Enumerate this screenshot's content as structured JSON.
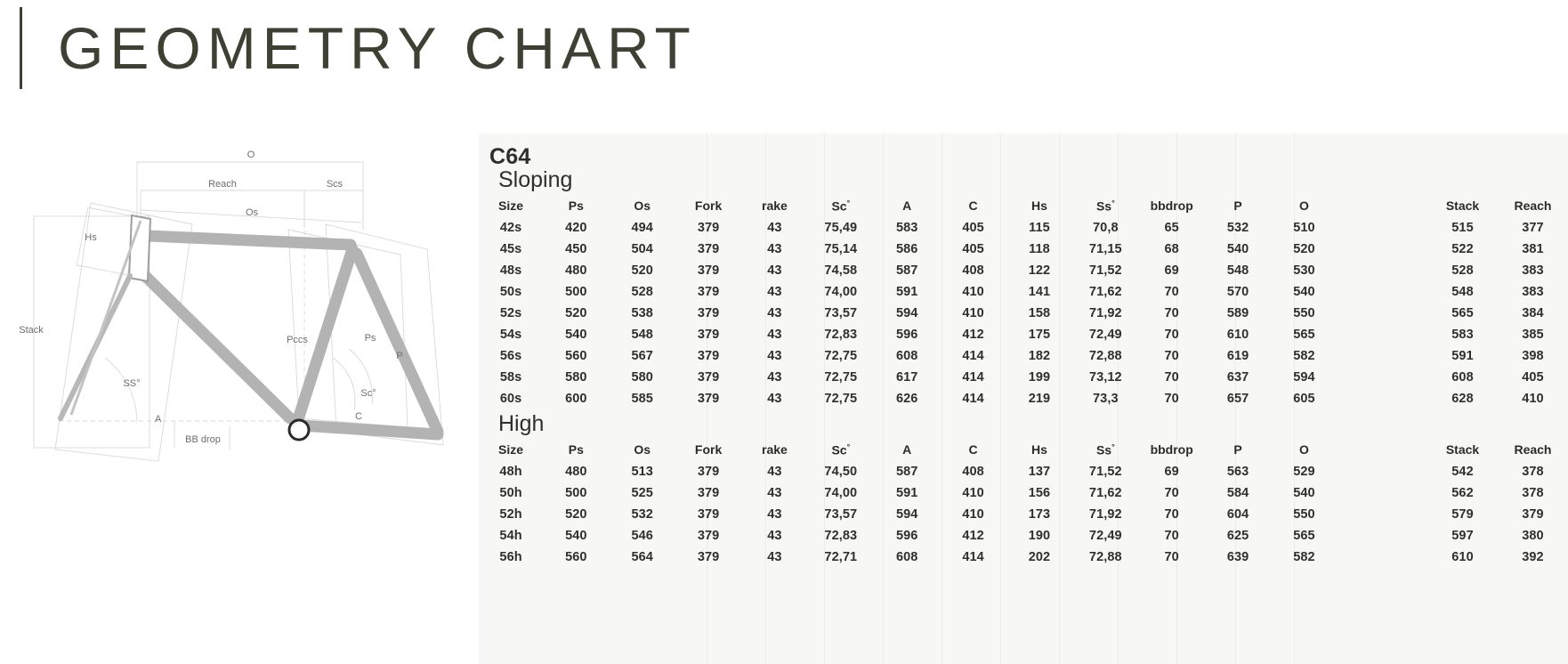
{
  "header": {
    "title": "GEOMETRY CHART",
    "accent_color": "#3e4033"
  },
  "diagram": {
    "name": "bicycle-frame-geometry-diagram",
    "labels": {
      "o": "O",
      "reach": "Reach",
      "scs": "Scs",
      "os": "Os",
      "hs": "Hs",
      "stack": "Stack",
      "pccs": "Pccs",
      "ps": "Ps",
      "p": "P",
      "ss_angle": "SS°",
      "sc_angle": "Sc°",
      "bb_drop": "BB drop",
      "a": "A",
      "c": "C"
    }
  },
  "table": {
    "model": "C64",
    "panel_bg": "#f7f7f6",
    "columns": [
      "Size",
      "Ps",
      "Os",
      "Fork",
      "rake",
      "Sc°",
      "A",
      "C",
      "Hs",
      "Ss°",
      "bbdrop",
      "P",
      "O",
      "",
      "Stack",
      "Reach"
    ],
    "sections": [
      {
        "name": "Sloping",
        "rows": [
          [
            "42s",
            "420",
            "494",
            "379",
            "43",
            "75,49",
            "583",
            "405",
            "115",
            "70,8",
            "65",
            "532",
            "510",
            "",
            "515",
            "377"
          ],
          [
            "45s",
            "450",
            "504",
            "379",
            "43",
            "75,14",
            "586",
            "405",
            "118",
            "71,15",
            "68",
            "540",
            "520",
            "",
            "522",
            "381"
          ],
          [
            "48s",
            "480",
            "520",
            "379",
            "43",
            "74,58",
            "587",
            "408",
            "122",
            "71,52",
            "69",
            "548",
            "530",
            "",
            "528",
            "383"
          ],
          [
            "50s",
            "500",
            "528",
            "379",
            "43",
            "74,00",
            "591",
            "410",
            "141",
            "71,62",
            "70",
            "570",
            "540",
            "",
            "548",
            "383"
          ],
          [
            "52s",
            "520",
            "538",
            "379",
            "43",
            "73,57",
            "594",
            "410",
            "158",
            "71,92",
            "70",
            "589",
            "550",
            "",
            "565",
            "384"
          ],
          [
            "54s",
            "540",
            "548",
            "379",
            "43",
            "72,83",
            "596",
            "412",
            "175",
            "72,49",
            "70",
            "610",
            "565",
            "",
            "583",
            "385"
          ],
          [
            "56s",
            "560",
            "567",
            "379",
            "43",
            "72,75",
            "608",
            "414",
            "182",
            "72,88",
            "70",
            "619",
            "582",
            "",
            "591",
            "398"
          ],
          [
            "58s",
            "580",
            "580",
            "379",
            "43",
            "72,75",
            "617",
            "414",
            "199",
            "73,12",
            "70",
            "637",
            "594",
            "",
            "608",
            "405"
          ],
          [
            "60s",
            "600",
            "585",
            "379",
            "43",
            "72,75",
            "626",
            "414",
            "219",
            "73,3",
            "70",
            "657",
            "605",
            "",
            "628",
            "410"
          ]
        ]
      },
      {
        "name": "High",
        "rows": [
          [
            "48h",
            "480",
            "513",
            "379",
            "43",
            "74,50",
            "587",
            "408",
            "137",
            "71,52",
            "69",
            "563",
            "529",
            "",
            "542",
            "378"
          ],
          [
            "50h",
            "500",
            "525",
            "379",
            "43",
            "74,00",
            "591",
            "410",
            "156",
            "71,62",
            "70",
            "584",
            "540",
            "",
            "562",
            "378"
          ],
          [
            "52h",
            "520",
            "532",
            "379",
            "43",
            "73,57",
            "594",
            "410",
            "173",
            "71,92",
            "70",
            "604",
            "550",
            "",
            "579",
            "379"
          ],
          [
            "54h",
            "540",
            "546",
            "379",
            "43",
            "72,83",
            "596",
            "412",
            "190",
            "72,49",
            "70",
            "625",
            "565",
            "",
            "597",
            "380"
          ],
          [
            "56h",
            "560",
            "564",
            "379",
            "43",
            "72,71",
            "608",
            "414",
            "202",
            "72,88",
            "70",
            "639",
            "582",
            "",
            "610",
            "392"
          ]
        ]
      }
    ]
  },
  "chart_data": {
    "type": "table",
    "title": "GEOMETRY CHART",
    "subtitle": "C64",
    "columns": [
      "Size",
      "Ps",
      "Os",
      "Fork",
      "rake",
      "Sc°",
      "A",
      "C",
      "Hs",
      "Ss°",
      "bbdrop",
      "P",
      "O",
      "Stack",
      "Reach"
    ],
    "groups": [
      {
        "name": "Sloping",
        "rows": [
          {
            "Size": "42s",
            "Ps": 420,
            "Os": 494,
            "Fork": 379,
            "rake": 43,
            "Sc": 75.49,
            "A": 583,
            "C": 405,
            "Hs": 115,
            "Ss": 70.8,
            "bbdrop": 65,
            "P": 532,
            "O": 510,
            "Stack": 515,
            "Reach": 377
          },
          {
            "Size": "45s",
            "Ps": 450,
            "Os": 504,
            "Fork": 379,
            "rake": 43,
            "Sc": 75.14,
            "A": 586,
            "C": 405,
            "Hs": 118,
            "Ss": 71.15,
            "bbdrop": 68,
            "P": 540,
            "O": 520,
            "Stack": 522,
            "Reach": 381
          },
          {
            "Size": "48s",
            "Ps": 480,
            "Os": 520,
            "Fork": 379,
            "rake": 43,
            "Sc": 74.58,
            "A": 587,
            "C": 408,
            "Hs": 122,
            "Ss": 71.52,
            "bbdrop": 69,
            "P": 548,
            "O": 530,
            "Stack": 528,
            "Reach": 383
          },
          {
            "Size": "50s",
            "Ps": 500,
            "Os": 528,
            "Fork": 379,
            "rake": 43,
            "Sc": 74.0,
            "A": 591,
            "C": 410,
            "Hs": 141,
            "Ss": 71.62,
            "bbdrop": 70,
            "P": 570,
            "O": 540,
            "Stack": 548,
            "Reach": 383
          },
          {
            "Size": "52s",
            "Ps": 520,
            "Os": 538,
            "Fork": 379,
            "rake": 43,
            "Sc": 73.57,
            "A": 594,
            "C": 410,
            "Hs": 158,
            "Ss": 71.92,
            "bbdrop": 70,
            "P": 589,
            "O": 550,
            "Stack": 565,
            "Reach": 384
          },
          {
            "Size": "54s",
            "Ps": 540,
            "Os": 548,
            "Fork": 379,
            "rake": 43,
            "Sc": 72.83,
            "A": 596,
            "C": 412,
            "Hs": 175,
            "Ss": 72.49,
            "bbdrop": 70,
            "P": 610,
            "O": 565,
            "Stack": 583,
            "Reach": 385
          },
          {
            "Size": "56s",
            "Ps": 560,
            "Os": 567,
            "Fork": 379,
            "rake": 43,
            "Sc": 72.75,
            "A": 608,
            "C": 414,
            "Hs": 182,
            "Ss": 72.88,
            "bbdrop": 70,
            "P": 619,
            "O": 582,
            "Stack": 591,
            "Reach": 398
          },
          {
            "Size": "58s",
            "Ps": 580,
            "Os": 580,
            "Fork": 379,
            "rake": 43,
            "Sc": 72.75,
            "A": 617,
            "C": 414,
            "Hs": 199,
            "Ss": 73.12,
            "bbdrop": 70,
            "P": 637,
            "O": 594,
            "Stack": 608,
            "Reach": 405
          },
          {
            "Size": "60s",
            "Ps": 600,
            "Os": 585,
            "Fork": 379,
            "rake": 43,
            "Sc": 72.75,
            "A": 626,
            "C": 414,
            "Hs": 219,
            "Ss": 73.3,
            "bbdrop": 70,
            "P": 657,
            "O": 605,
            "Stack": 628,
            "Reach": 410
          }
        ]
      },
      {
        "name": "High",
        "rows": [
          {
            "Size": "48h",
            "Ps": 480,
            "Os": 513,
            "Fork": 379,
            "rake": 43,
            "Sc": 74.5,
            "A": 587,
            "C": 408,
            "Hs": 137,
            "Ss": 71.52,
            "bbdrop": 69,
            "P": 563,
            "O": 529,
            "Stack": 542,
            "Reach": 378
          },
          {
            "Size": "50h",
            "Ps": 500,
            "Os": 525,
            "Fork": 379,
            "rake": 43,
            "Sc": 74.0,
            "A": 591,
            "C": 410,
            "Hs": 156,
            "Ss": 71.62,
            "bbdrop": 70,
            "P": 584,
            "O": 540,
            "Stack": 562,
            "Reach": 378
          },
          {
            "Size": "52h",
            "Ps": 520,
            "Os": 532,
            "Fork": 379,
            "rake": 43,
            "Sc": 73.57,
            "A": 594,
            "C": 410,
            "Hs": 173,
            "Ss": 71.92,
            "bbdrop": 70,
            "P": 604,
            "O": 550,
            "Stack": 579,
            "Reach": 379
          },
          {
            "Size": "54h",
            "Ps": 540,
            "Os": 546,
            "Fork": 379,
            "rake": 43,
            "Sc": 72.83,
            "A": 596,
            "C": 412,
            "Hs": 190,
            "Ss": 72.49,
            "bbdrop": 70,
            "P": 625,
            "O": 565,
            "Stack": 597,
            "Reach": 380
          },
          {
            "Size": "56h",
            "Ps": 560,
            "Os": 564,
            "Fork": 379,
            "rake": 43,
            "Sc": 72.71,
            "A": 608,
            "C": 414,
            "Hs": 202,
            "Ss": 72.88,
            "bbdrop": 70,
            "P": 639,
            "O": 582,
            "Stack": 610,
            "Reach": 392
          }
        ]
      }
    ]
  }
}
